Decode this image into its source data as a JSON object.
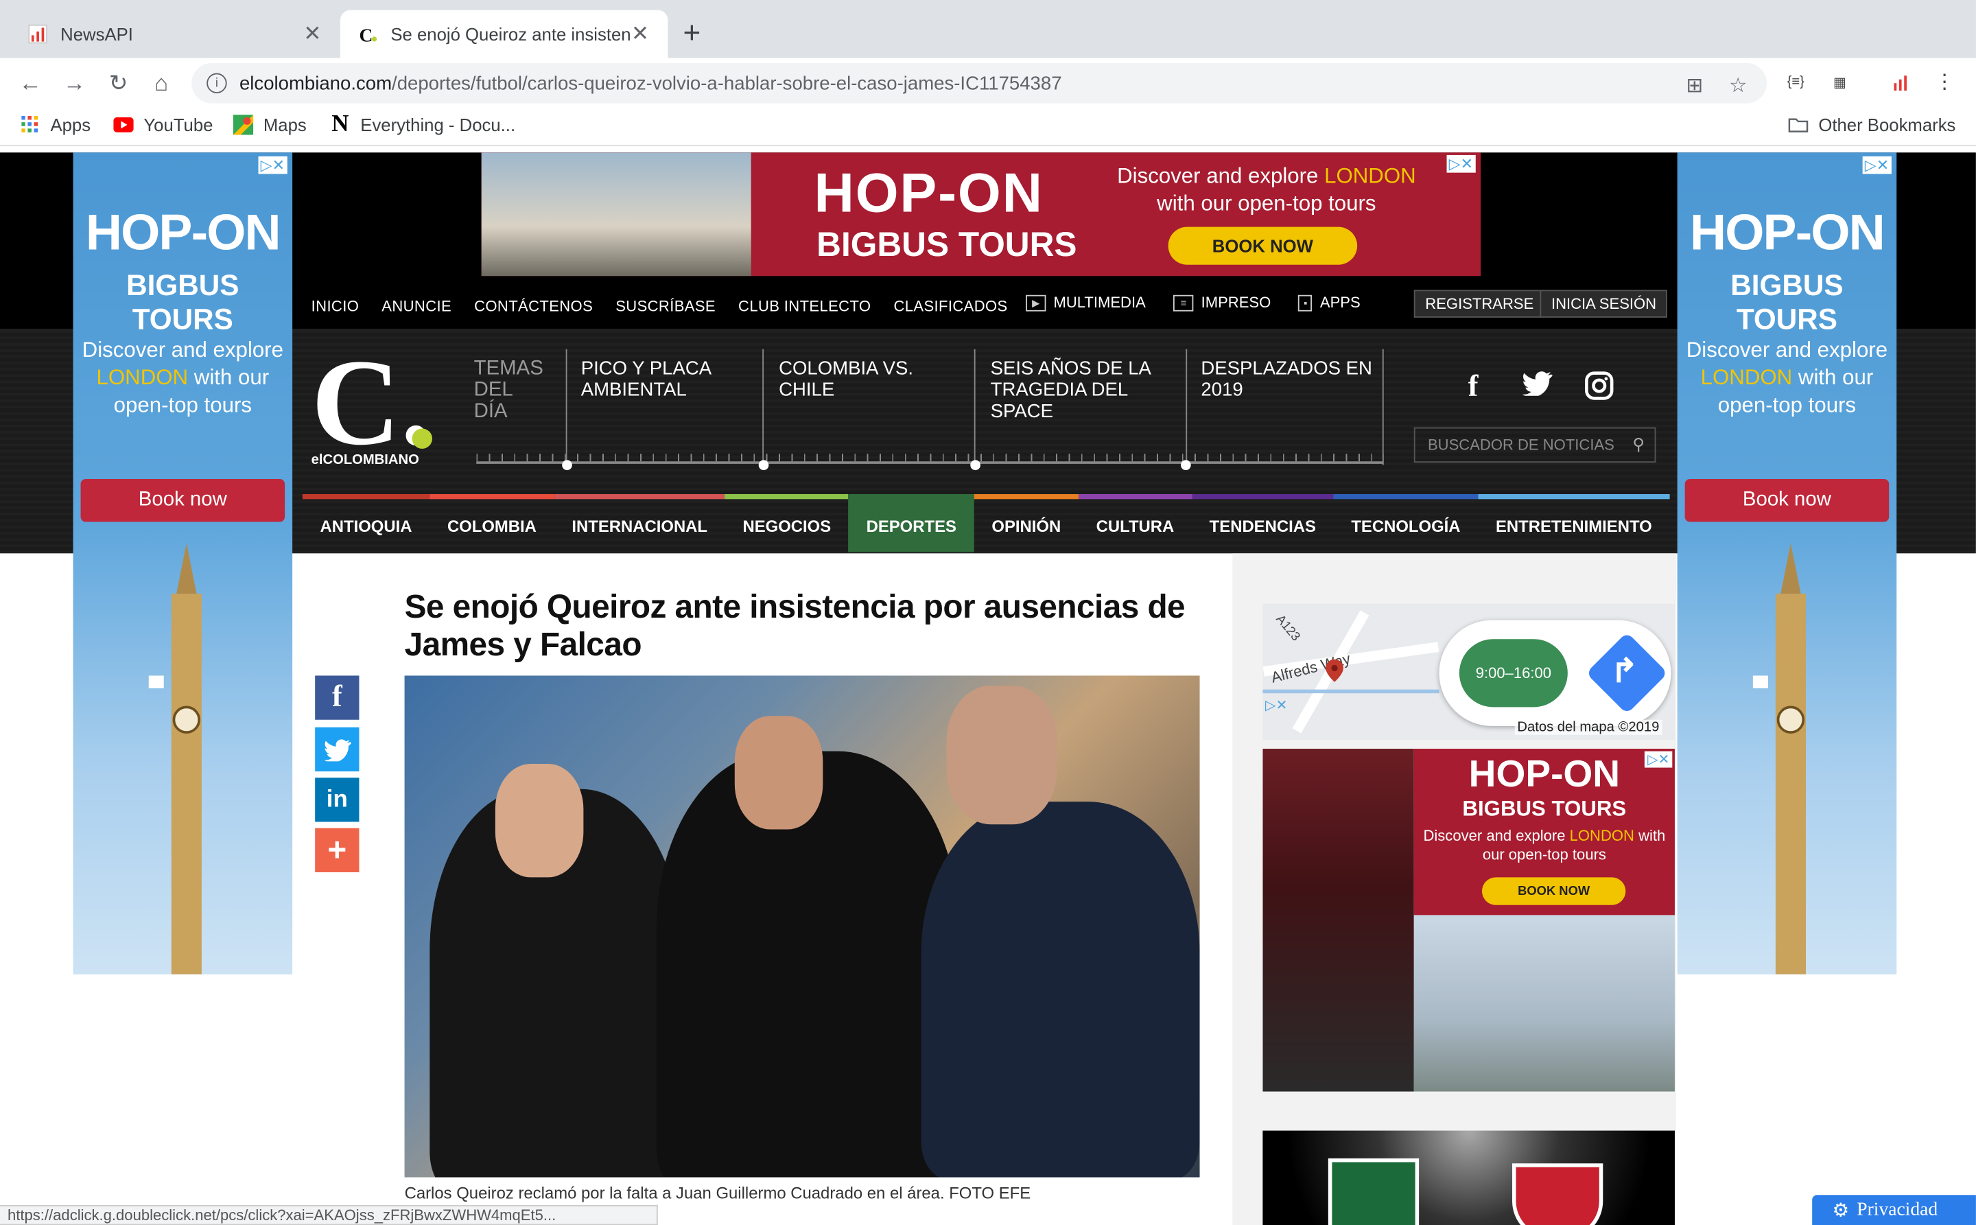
{
  "browser": {
    "tabs": [
      {
        "title": "NewsAPI",
        "active": false
      },
      {
        "title": "Se enojó Queiroz ante insistencia",
        "active": true
      }
    ],
    "url_host": "elcolombiano.com",
    "url_path": "/deportes/futbol/carlos-queiroz-volvio-a-hablar-sobre-el-caso-james-IC11754387",
    "bookmarks": [
      "Apps",
      "YouTube",
      "Maps",
      "Everything - Docu..."
    ],
    "other_bookmarks": "Other Bookmarks",
    "status_url": "https://adclick.g.doubleclick.net/pcs/click?xai=AKAOjss_zFRjBwxZWHW4mqEt5..."
  },
  "ads": {
    "hop_on": "HOP-ON",
    "bigbus": "BIGBUS TOURS",
    "discover_pre": "Discover and explore ",
    "london": "LONDON",
    "discover_post": " with our open-top tours",
    "book_now_upper": "BOOK NOW",
    "book_now": "Book now",
    "ad_marks": "▷✕",
    "map_hours": "9:00–16:00",
    "map_copyright": "Datos del mapa ©2019",
    "map_street": "Alfreds Way",
    "map_road": "A123"
  },
  "site": {
    "utility_nav": [
      "INICIO",
      "ANUNCIE",
      "CONTÁCTENOS",
      "SUSCRÍBASE",
      "CLUB INTELECTO",
      "CLASIFICADOS"
    ],
    "media_nav": [
      "MULTIMEDIA",
      "IMPRESO",
      "APPS"
    ],
    "register": "REGISTRARSE",
    "login": "INICIA SESIÓN",
    "logo_letter": "C.",
    "logo_name": "elCOLOMBIANO",
    "temas_label": "TEMAS DEL DÍA",
    "topics": [
      "PICO Y PLACA AMBIENTAL",
      "COLOMBIA VS. CHILE",
      "SEIS AÑOS DE LA TRAGEDIA DEL SPACE",
      "DESPLAZADOS EN 2019"
    ],
    "search_placeholder": "BUSCADOR DE NOTICIAS",
    "sections": [
      {
        "label": "ANTIOQUIA",
        "color": "#c0392b"
      },
      {
        "label": "COLOMBIA",
        "color": "#e74c3c"
      },
      {
        "label": "INTERNACIONAL",
        "color": "#d35454"
      },
      {
        "label": "NEGOCIOS",
        "color": "#8bc34a"
      },
      {
        "label": "DEPORTES",
        "color": "#2f6b3b"
      },
      {
        "label": "OPINIÓN",
        "color": "#e67e22"
      },
      {
        "label": "CULTURA",
        "color": "#8e44ad"
      },
      {
        "label": "TENDENCIAS",
        "color": "#5b2c8f"
      },
      {
        "label": "TECNOLOGÍA",
        "color": "#2e5fb8"
      },
      {
        "label": "ENTRETENIMIENTO",
        "color": "#5dade2"
      }
    ]
  },
  "article": {
    "headline": "Se enojó Queiroz ante insistencia por ausencias de James y Falcao",
    "caption": "Carlos Queiroz reclamó por la falta a Juan Guillermo Cuadrado en el área. FOTO EFE",
    "share_icons": [
      "facebook-icon",
      "twitter-icon",
      "linkedin-icon",
      "plus-icon"
    ]
  },
  "privacy": "Privacidad"
}
